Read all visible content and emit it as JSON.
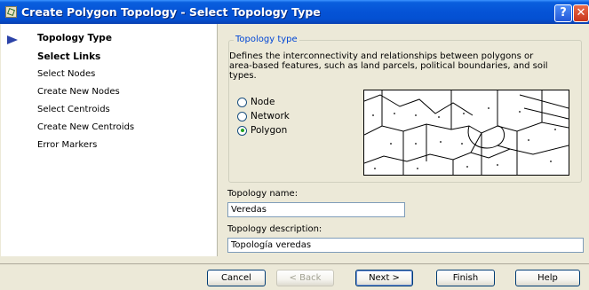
{
  "window": {
    "title": "Create Polygon Topology - Select Topology Type",
    "help_glyph": "?",
    "close_glyph": "✕",
    "app_icon": "topology-icon"
  },
  "steps": [
    {
      "label": "Topology Type",
      "bold": true,
      "current": true
    },
    {
      "label": "Select Links",
      "bold": true
    },
    {
      "label": "Select Nodes"
    },
    {
      "label": "Create New Nodes"
    },
    {
      "label": "Select Centroids"
    },
    {
      "label": "Create New Centroids"
    },
    {
      "label": "Error Markers"
    }
  ],
  "topology_group": {
    "title": "Topology type",
    "description": "Defines the interconnectivity and relationships between polygons or area-based features, such as land parcels, political boundaries, and soil types.",
    "options": [
      {
        "label": "Node",
        "checked": false
      },
      {
        "label": "Network",
        "checked": false
      },
      {
        "label": "Polygon",
        "checked": true
      }
    ]
  },
  "fields": {
    "name_label": "Topology name:",
    "name_value": "Veredas",
    "description_label": "Topology description:",
    "description_value": "Topología veredas"
  },
  "buttons": {
    "cancel": "Cancel",
    "back": "< Back",
    "next": "Next >",
    "finish": "Finish",
    "help": "Help"
  },
  "colors": {
    "title_bar": "#0553d6",
    "group_title": "#0046d5",
    "step_arrow": "#2c43a8",
    "radio_checked": "#21a121"
  }
}
